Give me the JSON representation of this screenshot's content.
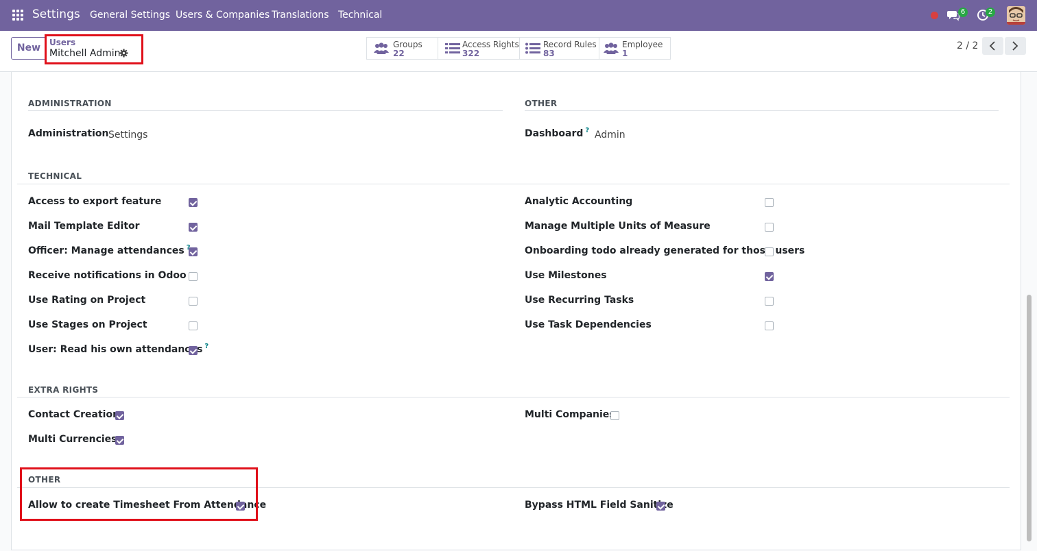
{
  "navbar": {
    "app_name": "Settings",
    "menu": [
      "General Settings",
      "Users & Companies",
      "Translations",
      "Technical"
    ],
    "chat_count": "6",
    "activity_count": "2",
    "colors": {
      "bar": "#71639e",
      "badge": "#28a745",
      "record": "#d84040"
    }
  },
  "control": {
    "new_label": "New",
    "breadcrumb_parent": "Users",
    "breadcrumb_current": "Mitchell Admin",
    "smart_buttons": [
      {
        "label": "Groups",
        "value": "22",
        "icon": "users-icon"
      },
      {
        "label": "Access Rights",
        "value": "322",
        "icon": "list-icon"
      },
      {
        "label": "Record Rules",
        "value": "83",
        "icon": "list-icon"
      },
      {
        "label": "Employee",
        "value": "1",
        "icon": "users-icon"
      }
    ],
    "pager": "2 / 2"
  },
  "sections": {
    "administration": {
      "title": "ADMINISTRATION",
      "field_label": "Administration",
      "field_value": "Settings"
    },
    "other_top": {
      "title": "OTHER",
      "field_label": "Dashboard",
      "help": "?",
      "field_value": "Admin"
    },
    "technical": {
      "title": "TECHNICAL",
      "left": [
        {
          "label": "Access to export feature",
          "checked": true,
          "help": ""
        },
        {
          "label": "Mail Template Editor",
          "checked": true,
          "help": ""
        },
        {
          "label": "Officer: Manage attendances",
          "checked": true,
          "help": "?"
        },
        {
          "label": "Receive notifications in Odoo",
          "checked": false,
          "help": ""
        },
        {
          "label": "Use Rating on Project",
          "checked": false,
          "help": ""
        },
        {
          "label": "Use Stages on Project",
          "checked": false,
          "help": ""
        },
        {
          "label": "User: Read his own attendances",
          "checked": true,
          "help": "?"
        }
      ],
      "right": [
        {
          "label": "Analytic Accounting",
          "checked": false
        },
        {
          "label": "Manage Multiple Units of Measure",
          "checked": false
        },
        {
          "label": "Onboarding todo already generated for those users",
          "checked": false
        },
        {
          "label": "Use Milestones",
          "checked": true
        },
        {
          "label": "Use Recurring Tasks",
          "checked": false
        },
        {
          "label": "Use Task Dependencies",
          "checked": false
        }
      ]
    },
    "extra_rights": {
      "title": "EXTRA RIGHTS",
      "left": [
        {
          "label": "Contact Creation",
          "checked": true
        },
        {
          "label": "Multi Currencies",
          "checked": true
        }
      ],
      "right": [
        {
          "label": "Multi Companies",
          "checked": false
        }
      ]
    },
    "other_bottom": {
      "title": "OTHER",
      "left": [
        {
          "label": "Allow to create Timesheet From Attendance",
          "checked": true
        }
      ],
      "right": [
        {
          "label": "Bypass HTML Field Sanitize",
          "checked": true
        }
      ]
    }
  }
}
